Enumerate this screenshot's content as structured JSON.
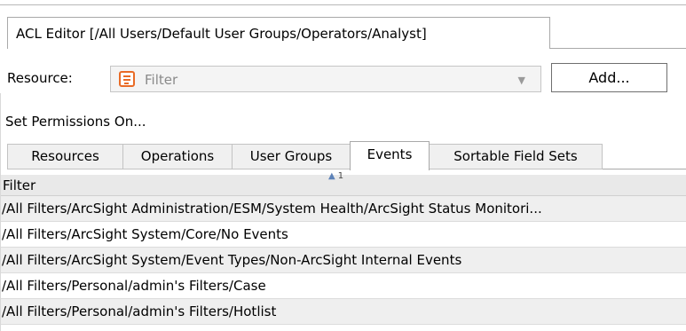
{
  "editor_tab": {
    "title": "ACL Editor [/All Users/Default User Groups/Operators/Analyst]"
  },
  "resource": {
    "label": "Resource:",
    "icon": "filter-icon",
    "value": "Filter",
    "add_label": "Add..."
  },
  "set_permissions_label": "Set Permissions On...",
  "tabs": [
    {
      "label": "Resources",
      "active": false
    },
    {
      "label": "Operations",
      "active": false
    },
    {
      "label": "User Groups",
      "active": false
    },
    {
      "label": "Events",
      "active": true
    },
    {
      "label": "Sortable Field Sets",
      "active": false
    }
  ],
  "grid": {
    "column_header": "Filter",
    "sort_index": "1",
    "rows": [
      "/All Filters/ArcSight Administration/ESM/System Health/ArcSight Status Monitori...",
      "/All Filters/ArcSight System/Core/No Events",
      "/All Filters/ArcSight System/Event Types/Non-ArcSight Internal Events",
      "/All Filters/Personal/admin's Filters/Case",
      "/All Filters/Personal/admin's Filters/Hotlist"
    ]
  },
  "colors": {
    "icon_accent": "#e96b26",
    "row_alt": "#efefef",
    "header_bg": "#e9e9e9"
  }
}
